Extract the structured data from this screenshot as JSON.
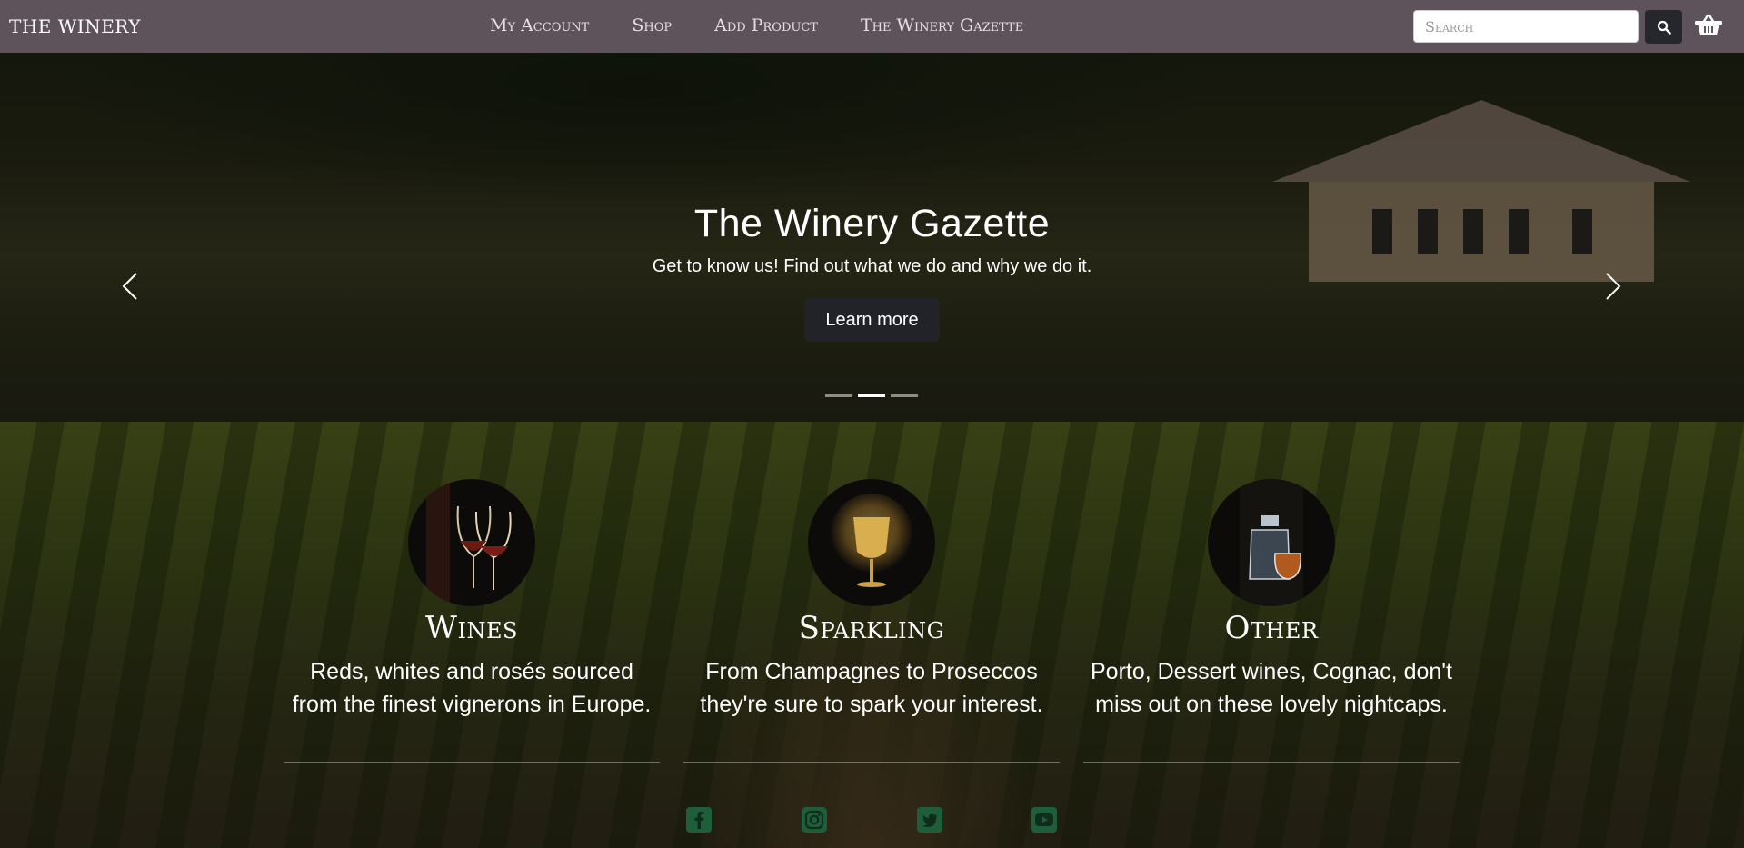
{
  "brand": "THE WINERY",
  "nav": {
    "links": [
      "My Account",
      "Shop",
      "Add Product",
      "The Winery Gazette"
    ]
  },
  "search": {
    "placeholder": "Search"
  },
  "hero": {
    "title": "The Winery Gazette",
    "subtitle": "Get to know us! Find out what we do and why we do it.",
    "button_label": "Learn more",
    "slide_count": 3,
    "active_slide": 2
  },
  "categories": [
    {
      "title": "Wines",
      "description": "Reds, whites and rosés sourced from the finest vignerons in Europe.",
      "icon": "wine-glasses-icon"
    },
    {
      "title": "Sparkling",
      "description": "From Champagnes to Proseccos they're sure to spark your interest.",
      "icon": "sparkling-glass-icon"
    },
    {
      "title": "Other",
      "description": "Porto, Dessert wines, Cognac, don't miss out on these lovely nightcaps.",
      "icon": "decanter-icon"
    }
  ],
  "social": [
    {
      "icon": "facebook-icon"
    },
    {
      "icon": "instagram-icon"
    },
    {
      "icon": "twitter-icon"
    },
    {
      "icon": "youtube-icon"
    }
  ],
  "colors": {
    "navbar": "#5e535b",
    "button_dark": "#222329",
    "social_green": "#1f5e3a"
  }
}
